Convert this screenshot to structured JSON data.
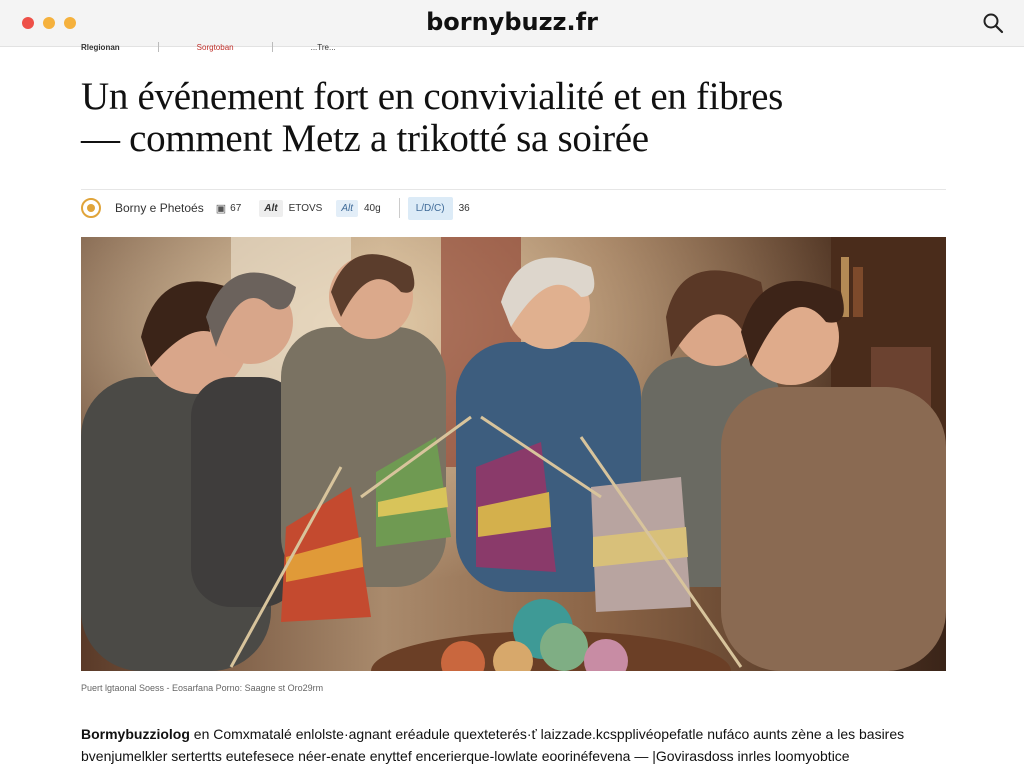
{
  "browser": {
    "site_title": "bornybuzz.fr",
    "dots": [
      "#ee5048",
      "#f5b13d",
      "#f5b13d"
    ]
  },
  "crumbs": {
    "section": "Rlegionan",
    "tag": "Sorgtoban",
    "info": "...Tre..."
  },
  "article": {
    "headline_line1": "Un événement fort en convivialité et en fibres",
    "headline_line2": "— comment Metz a trikotté sa soirée",
    "author": "Borny e Phetoés",
    "comments_count": "67",
    "chip1": "Alt",
    "chip1_text": "ETOVS",
    "chip2": "Alt",
    "chip2_text": "40g",
    "chip3": "L/D/C)",
    "views": "36",
    "caption": "Puert lgtaonal Soess - Eosarfana Porno: Saagne st Oro29rm",
    "body_lead": "Bormybuzziolog",
    "body_line1": " en Comxmatalé enlolste·agnant eréadule quexteterés·ť laizzade.kcspplivéopefatle nufáco aunts zène a les basires",
    "body_line2": "bvenjumelkler sertertts eutefesece néer-enate enyttef encerierque-lowlate eoorinéfevena — |Govirasdoss inrles loomyobtice"
  },
  "colors": {
    "accent_red": "#c0302b",
    "logo_gold": "#e0a43a",
    "chip_blue": "#3e6a98"
  }
}
